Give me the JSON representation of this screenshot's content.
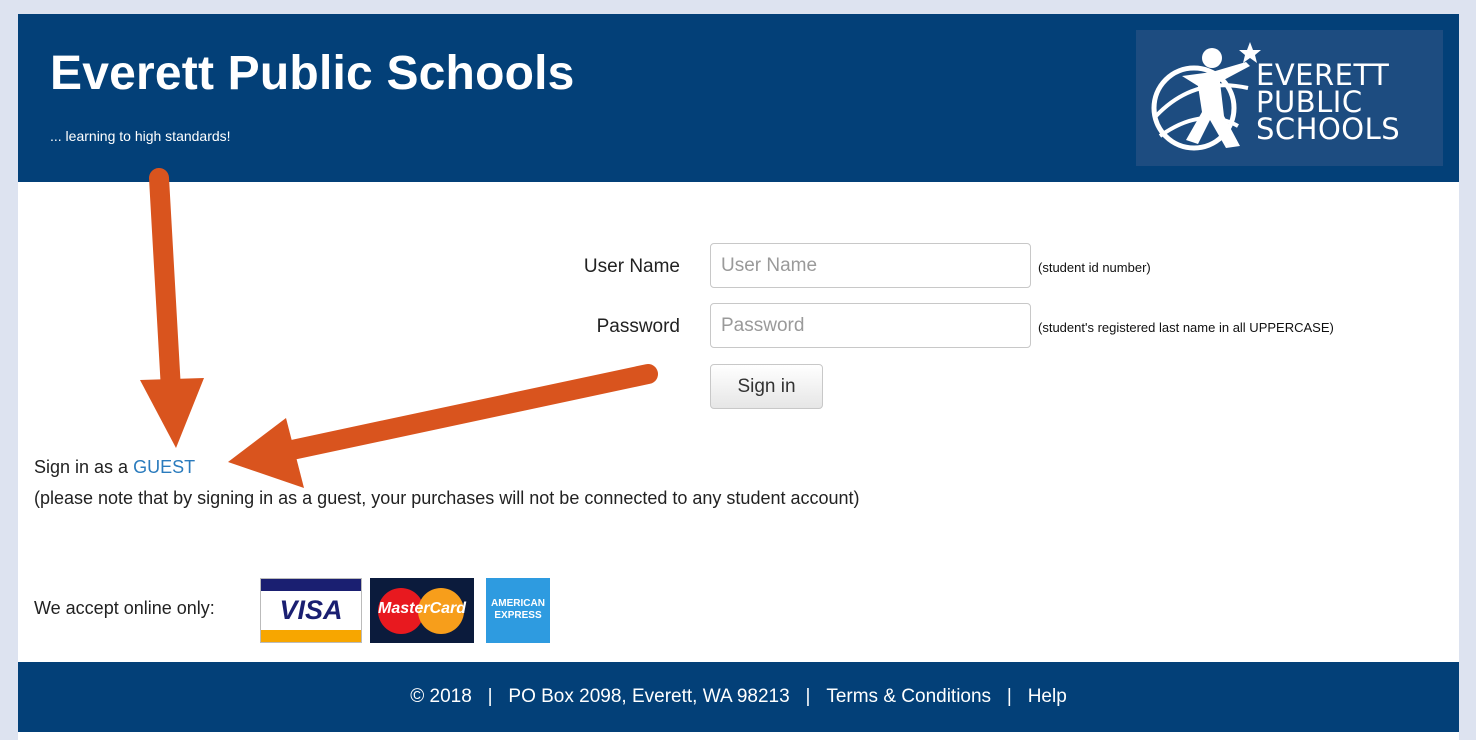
{
  "header": {
    "title": "Everett Public Schools",
    "tagline": "... learning to high standards!",
    "logo_lines": [
      "EVERETT",
      "PUBLIC",
      "SCHOOLS"
    ]
  },
  "login": {
    "username_label": "User Name",
    "username_placeholder": "User Name",
    "username_hint": "(student id number)",
    "password_label": "Password",
    "password_placeholder": "Password",
    "password_hint": "(student's registered last name in all UPPERCASE)",
    "signin_label": "Sign in"
  },
  "guest": {
    "prefix": "Sign in as a ",
    "link": "GUEST",
    "note": "(please note that by signing in as a guest, your purchases will not be connected to any student account)"
  },
  "payment": {
    "accept_label": "We accept online only:",
    "visa": "VISA",
    "mastercard": "MasterCard",
    "amex": "AMERICAN EXPRESS"
  },
  "footer": {
    "copyright": "© 2018",
    "sep": "|",
    "address": "PO Box 2098, Everett, WA 98213",
    "terms": "Terms & Conditions",
    "help": "Help"
  },
  "colors": {
    "brand_navy": "#034078",
    "link_blue": "#2a7bbd",
    "annotation_arrow": "#d9541e"
  }
}
